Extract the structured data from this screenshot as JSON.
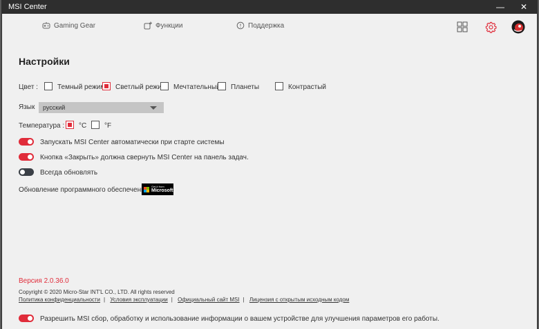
{
  "window": {
    "title": "MSI Center",
    "minimize": "—",
    "close": "✕"
  },
  "nav": {
    "gaming_gear": "Gaming Gear",
    "functions": "Функции",
    "support": "Поддержка"
  },
  "page_title": "Настройки",
  "color": {
    "label": "Цвет :",
    "options": [
      {
        "label": "Темный режим",
        "checked": false
      },
      {
        "label": "Светлый режим",
        "checked": true
      },
      {
        "label": "Мечтательный",
        "checked": false
      },
      {
        "label": "Планеты",
        "checked": false
      },
      {
        "label": "Контрастый",
        "checked": false
      }
    ]
  },
  "language": {
    "label": "Язык",
    "value": "русский"
  },
  "temperature": {
    "label": "Температура :",
    "celsius": "°C",
    "fahrenheit": "°F",
    "selected": "celsius"
  },
  "toggles": [
    {
      "label": "Запускать MSI Center автоматически при старте системы",
      "on": true
    },
    {
      "label": "Кнопка «Закрыть» должна свернуть MSI Center на панель задач.",
      "on": true
    },
    {
      "label": "Всегда обновлять",
      "on": false
    }
  ],
  "software_update": {
    "label": "Обновление программного обеспечения",
    "badge_small": "Get it from",
    "badge_big": "Microsoft"
  },
  "version": "Версия 2.0.36.0",
  "copyright": "Copyright © 2020 Micro-Star INT'L CO., LTD. All rights reserved",
  "links": [
    "Политика конфиденциальности",
    "Условия эксплуатации",
    "Официальный сайт MSI",
    "Лицензия с открытым исходным кодом"
  ],
  "consent": {
    "label": "Разрешить MSI сбор, обработку и использование информации о вашем устройстве для улучшения параметров его работы.",
    "on": true
  },
  "colors": {
    "accent": "#e02c3a",
    "titlebar": "#2e2e2e",
    "background": "#f0f0f0"
  }
}
